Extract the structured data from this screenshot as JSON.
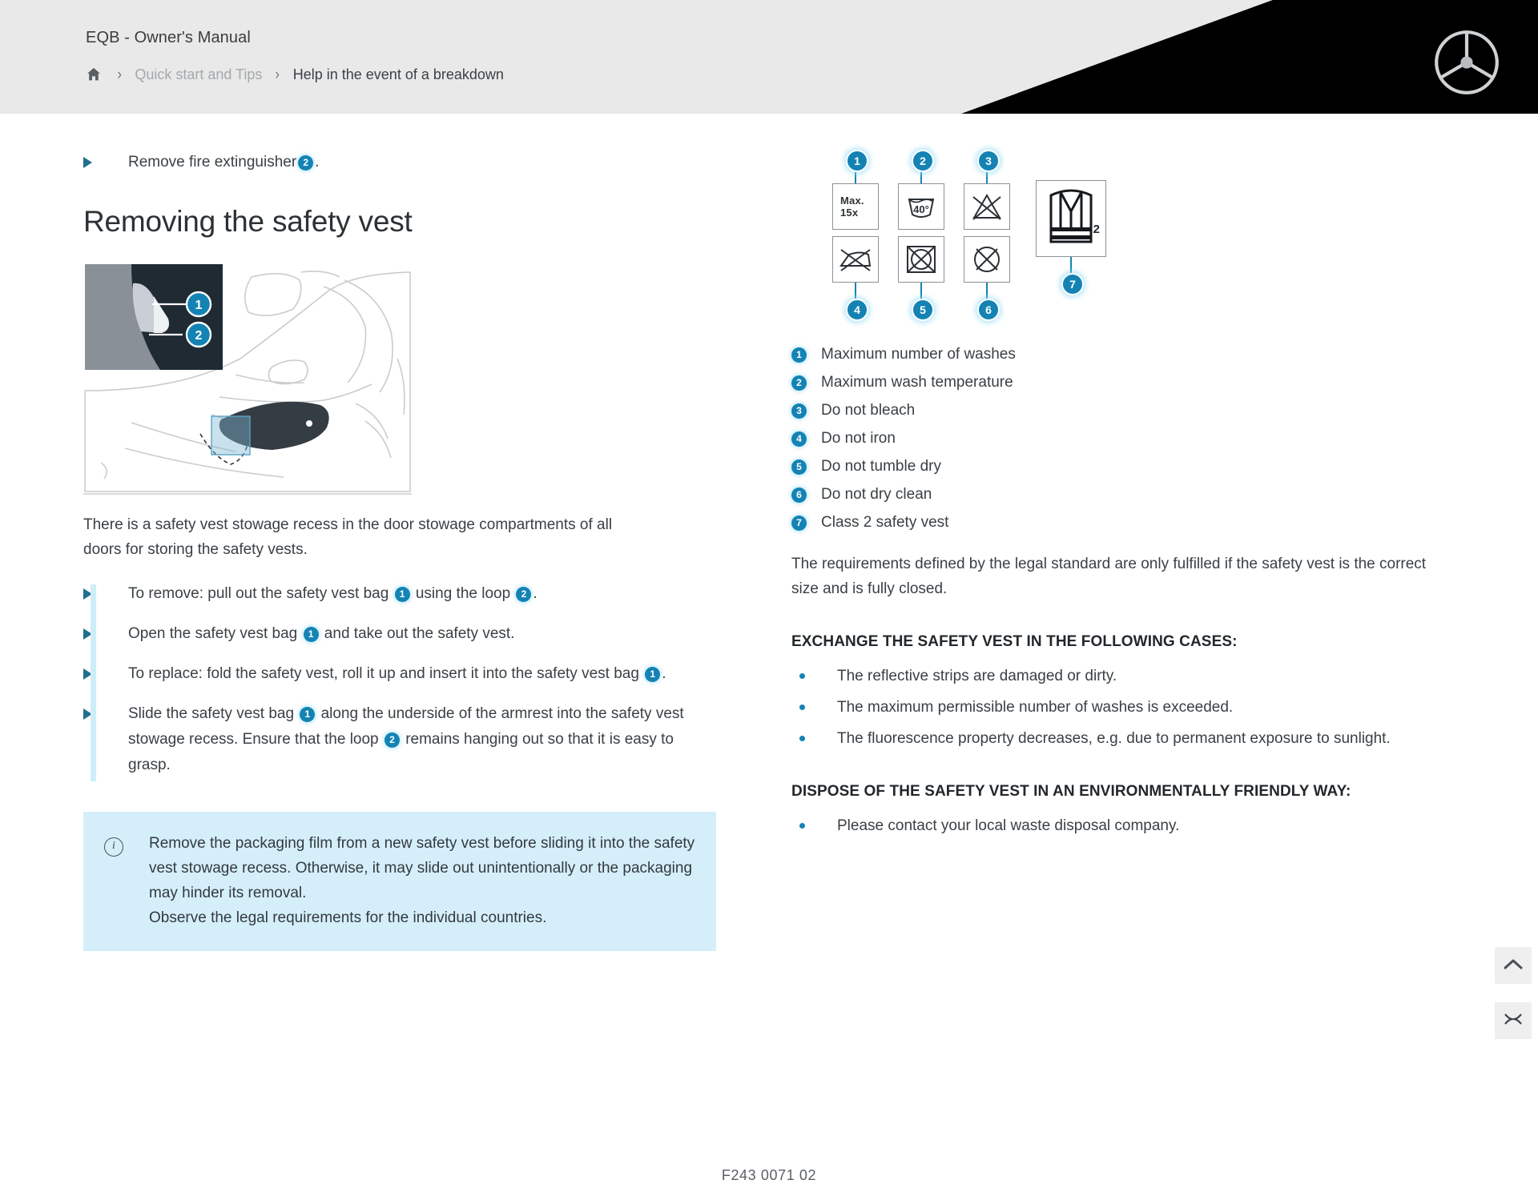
{
  "header": {
    "title": "EQB - Owner's Manual",
    "breadcrumb": {
      "home_icon": "home-icon",
      "separator": "›",
      "parent": "Quick start and Tips",
      "current": "Help in the event of a breakdown"
    },
    "brand_logo": "mercedes-benz-star-icon",
    "accent_color": "#1483b4",
    "header_bg": "#e9e9e9",
    "header_black": "#000000"
  },
  "left": {
    "top_action": {
      "text_before": "Remove fire extinguisher",
      "marker": "2",
      "text_after": "."
    },
    "section_title": "Removing the safety vest",
    "illustration": {
      "name": "door-stowage-compartment-illustration",
      "callouts": [
        "1",
        "2"
      ]
    },
    "intro_paragraph": "There is a safety vest stowage recess in the door stowage compartments of all doors for storing the safety vests.",
    "steps": [
      {
        "parts": [
          {
            "t": "To remove: pull out the safety vest bag "
          },
          {
            "n": "1"
          },
          {
            "t": " using the loop "
          },
          {
            "n": "2"
          },
          {
            "t": "."
          }
        ]
      },
      {
        "parts": [
          {
            "t": "Open the safety vest bag "
          },
          {
            "n": "1"
          },
          {
            "t": " and take out the safety vest."
          }
        ]
      },
      {
        "parts": [
          {
            "t": "To replace: fold the safety vest, roll it up and insert it into the safety vest bag "
          },
          {
            "n": "1"
          },
          {
            "t": "."
          }
        ]
      },
      {
        "parts": [
          {
            "t": "Slide the safety vest bag "
          },
          {
            "n": "1"
          },
          {
            "t": " along the underside of the armrest into the safety vest stowage recess. Ensure that the loop "
          },
          {
            "n": "2"
          },
          {
            "t": " remains hanging out so that it is easy to grasp."
          }
        ]
      }
    ],
    "info_box": {
      "icon": "info-icon",
      "text": "Remove the packaging film from a new safety vest before sliding it into the safety vest stowage recess. Otherwise, it may slide out unintentionally or the packaging may hinder its removal.\nObserve the legal requirements for the individual countries.",
      "bg_color": "#d5effa"
    }
  },
  "right": {
    "symbols": [
      {
        "n": "1",
        "label": "Max. 15x",
        "icon": "max-washes-symbol",
        "lines": [
          "Max.",
          "15x"
        ]
      },
      {
        "n": "2",
        "label": "40°",
        "icon": "wash-temperature-symbol"
      },
      {
        "n": "3",
        "label": "",
        "icon": "do-not-bleach-symbol"
      },
      {
        "n": "4",
        "label": "",
        "icon": "do-not-iron-symbol"
      },
      {
        "n": "5",
        "label": "",
        "icon": "do-not-tumble-dry-symbol"
      },
      {
        "n": "6",
        "label": "",
        "icon": "do-not-dry-clean-symbol"
      },
      {
        "n": "7",
        "label": "2",
        "icon": "class-2-safety-vest-symbol"
      }
    ],
    "legend": [
      {
        "n": "1",
        "text": "Maximum number of washes"
      },
      {
        "n": "2",
        "text": "Maximum wash temperature"
      },
      {
        "n": "3",
        "text": "Do not bleach"
      },
      {
        "n": "4",
        "text": "Do not iron"
      },
      {
        "n": "5",
        "text": "Do not tumble dry"
      },
      {
        "n": "6",
        "text": "Do not dry clean"
      },
      {
        "n": "7",
        "text": "Class 2 safety vest"
      }
    ],
    "paragraph": "The requirements defined by the legal standard are only fulfilled if the safety vest is the correct size and is fully closed.",
    "exchange_heading": "EXCHANGE THE SAFETY VEST IN THE FOLLOWING CASES:",
    "exchange_items": [
      "The reflective strips are damaged or dirty.",
      "The maximum permissible number of washes is exceeded.",
      "The fluorescence property decreases, e.g. due to permanent exposure to sunlight."
    ],
    "dispose_heading": "DISPOSE OF THE SAFETY VEST IN AN ENVIRONMENTALLY FRIENDLY WAY:",
    "dispose_items": [
      "Please contact your local waste disposal company."
    ]
  },
  "controls": {
    "scroll_top": "chevron-up-icon",
    "secondary": "collapse-icon"
  },
  "footer": {
    "code": "F243 0071 02"
  }
}
